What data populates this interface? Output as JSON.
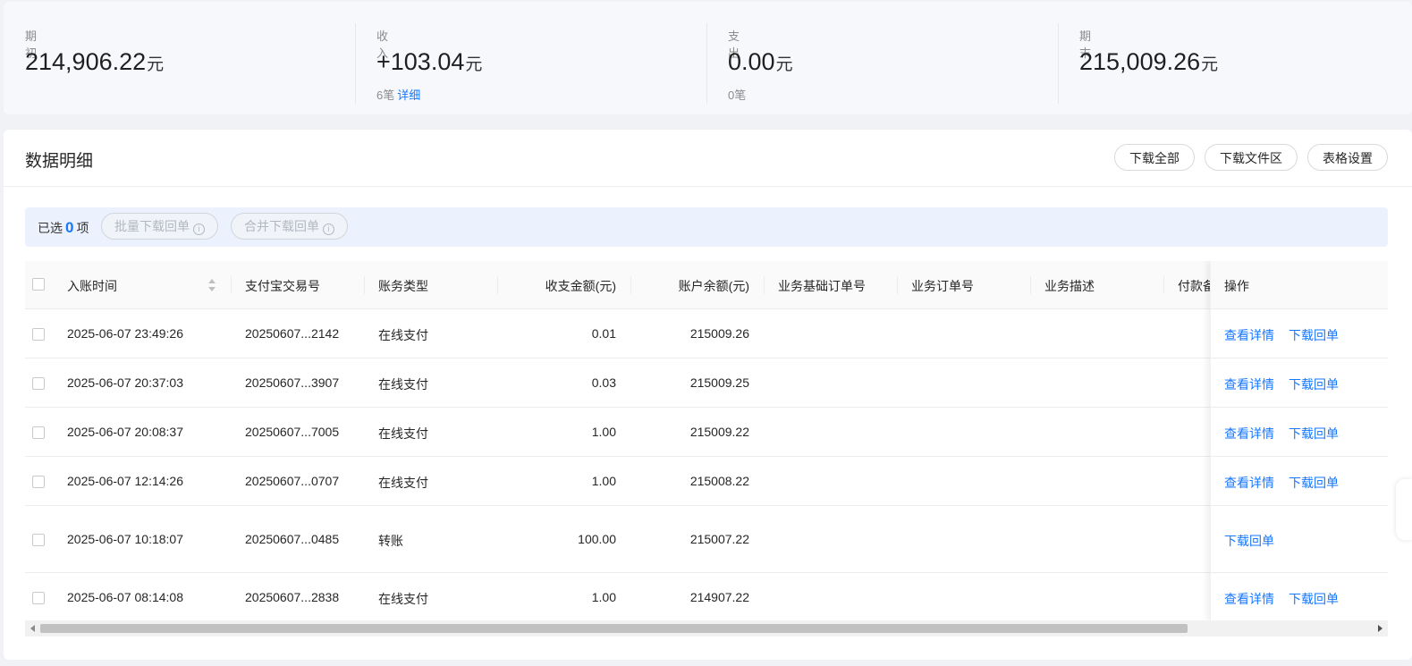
{
  "summary": {
    "opening": {
      "label": "期初",
      "amount": "214,906.22",
      "unit": "元"
    },
    "income": {
      "label": "收入",
      "amount": "+103.04",
      "unit": "元",
      "count": "6笔",
      "detail_link": "详细"
    },
    "expense": {
      "label": "支出",
      "amount": "0.00",
      "unit": "元",
      "count": "0笔"
    },
    "closing": {
      "label": "期末",
      "amount": "215,009.26",
      "unit": "元"
    }
  },
  "panel": {
    "title": "数据明细",
    "buttons": {
      "download_all": "下载全部",
      "download_area": "下载文件区",
      "table_settings": "表格设置"
    }
  },
  "selection": {
    "prefix": "已选",
    "count": "0",
    "suffix": "项",
    "batch_download": "批量下载回单",
    "merge_download": "合并下载回单",
    "info_glyph": "i"
  },
  "table": {
    "columns": {
      "time": "入账时间",
      "trade_no": "支付宝交易号",
      "type": "账务类型",
      "amount": "收支金额(元)",
      "balance": "账户余额(元)",
      "base_order": "业务基础订单号",
      "order": "业务订单号",
      "desc": "业务描述",
      "remark": "付款备",
      "ops": "操作"
    },
    "rows": [
      {
        "time": "2025-06-07 23:49:26",
        "trade_no": "20250607...2142",
        "type": "在线支付",
        "amount": "0.01",
        "balance": "215009.26",
        "ops": [
          "查看详情",
          "下载回单"
        ]
      },
      {
        "time": "2025-06-07 20:37:03",
        "trade_no": "20250607...3907",
        "type": "在线支付",
        "amount": "0.03",
        "balance": "215009.25",
        "ops": [
          "查看详情",
          "下载回单"
        ]
      },
      {
        "time": "2025-06-07 20:08:37",
        "trade_no": "20250607...7005",
        "type": "在线支付",
        "amount": "1.00",
        "balance": "215009.22",
        "ops": [
          "查看详情",
          "下载回单"
        ]
      },
      {
        "time": "2025-06-07 12:14:26",
        "trade_no": "20250607...0707",
        "type": "在线支付",
        "amount": "1.00",
        "balance": "215008.22",
        "ops": [
          "查看详情",
          "下载回单"
        ]
      },
      {
        "time": "2025-06-07 10:18:07",
        "trade_no": "20250607...0485",
        "type": "转账",
        "amount": "100.00",
        "balance": "215007.22",
        "ops": [
          "下载回单"
        ]
      },
      {
        "time": "2025-06-07 08:14:08",
        "trade_no": "20250607...2838",
        "type": "在线支付",
        "amount": "1.00",
        "balance": "214907.22",
        "ops": [
          "查看详情",
          "下载回单"
        ]
      }
    ]
  },
  "colors": {
    "accent": "#1677ff",
    "selection_bar": "#ebf2fd",
    "summary_bg": "#f6f8fc"
  }
}
